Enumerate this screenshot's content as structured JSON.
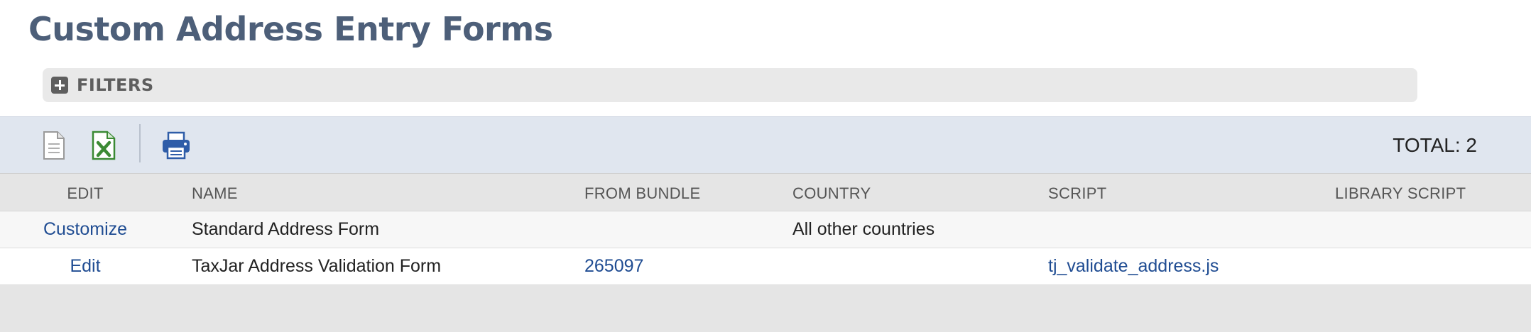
{
  "page": {
    "title": "Custom Address Entry Forms"
  },
  "filters": {
    "label": "FILTERS"
  },
  "toolbar": {
    "icons": [
      "document-icon",
      "excel-export-icon",
      "print-icon"
    ],
    "total_label": "TOTAL: 2"
  },
  "table": {
    "headers": {
      "edit": "EDIT",
      "name": "NAME",
      "bundle": "FROM BUNDLE",
      "country": "COUNTRY",
      "script": "SCRIPT",
      "library": "LIBRARY SCRIPT"
    },
    "rows": [
      {
        "edit": "Customize",
        "name": "Standard Address Form",
        "bundle": "",
        "country": "All other countries",
        "script": "",
        "library": ""
      },
      {
        "edit": "Edit",
        "name": "TaxJar Address Validation Form",
        "bundle": "265097",
        "country": "",
        "script": "tj_validate_address.js",
        "library": ""
      }
    ]
  },
  "colors": {
    "title": "#4d5f79",
    "link": "#1f4c92",
    "toolbar_bg": "#e0e6ef",
    "excel_green": "#3b8a34",
    "print_blue": "#2f5da8"
  }
}
